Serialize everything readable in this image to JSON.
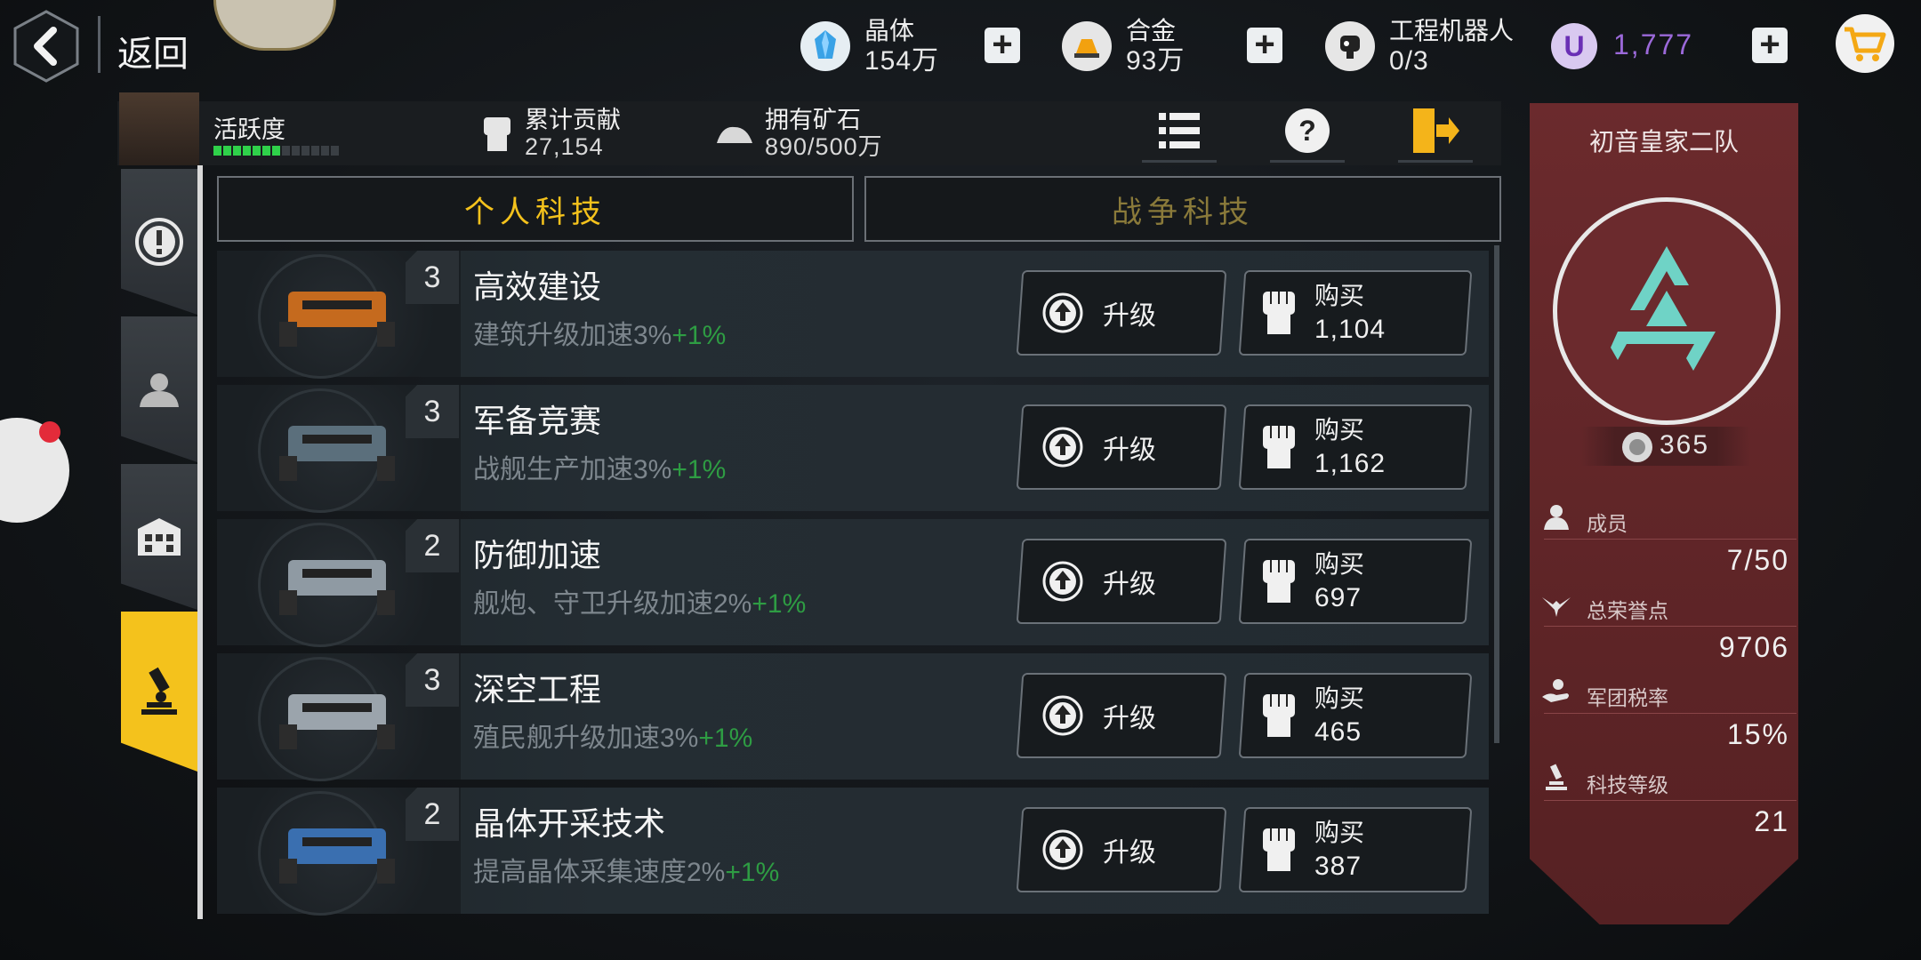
{
  "topbar": {
    "back_label": "返回",
    "resources": [
      {
        "name": "晶体",
        "value": "154万",
        "icon": "crystal-icon"
      },
      {
        "name": "合金",
        "value": "93万",
        "icon": "alloy-icon"
      },
      {
        "name": "工程机器人",
        "value": "0/3",
        "icon": "robot-icon"
      }
    ],
    "currency_value": "1,777",
    "currency_letter": "U"
  },
  "info": {
    "activity_label": "活跃度",
    "activity_level": 0.55,
    "contribution_label": "累计贡献",
    "contribution_value": "27,154",
    "ore_label": "拥有矿石",
    "ore_value": "890/500万"
  },
  "tabs": {
    "personal": "个人科技",
    "war": "战争科技"
  },
  "tech_rows": [
    {
      "level": "3",
      "title": "高效建设",
      "desc": "建筑升级加速3%",
      "bonus": "+1%",
      "upgrade": "升级",
      "buy": "购买",
      "price": "1,104"
    },
    {
      "level": "3",
      "title": "军备竞赛",
      "desc": "战舰生产加速3%",
      "bonus": "+1%",
      "upgrade": "升级",
      "buy": "购买",
      "price": "1,162"
    },
    {
      "level": "2",
      "title": "防御加速",
      "desc": "舰炮、守卫升级加速2%",
      "bonus": "+1%",
      "upgrade": "升级",
      "buy": "购买",
      "price": "697"
    },
    {
      "level": "3",
      "title": "深空工程",
      "desc": "殖民舰升级加速3%",
      "bonus": "+1%",
      "upgrade": "升级",
      "buy": "购买",
      "price": "465"
    },
    {
      "level": "2",
      "title": "晶体开采技术",
      "desc": "提高晶体采集速度2%",
      "bonus": "+1%",
      "upgrade": "升级",
      "buy": "购买",
      "price": "387"
    }
  ],
  "guild": {
    "name": "初音皇家二队",
    "points": "365",
    "stats": [
      {
        "label": "成员",
        "value": "7/50"
      },
      {
        "label": "总荣誉点",
        "value": "9706"
      },
      {
        "label": "军团税率",
        "value": "15%"
      },
      {
        "label": "科技等级",
        "value": "21"
      }
    ]
  },
  "colors": {
    "accent": "#f4c21c",
    "panel": "#6b2a2d",
    "bonus": "#2e9c43",
    "emblem": "#6fd3c6"
  }
}
